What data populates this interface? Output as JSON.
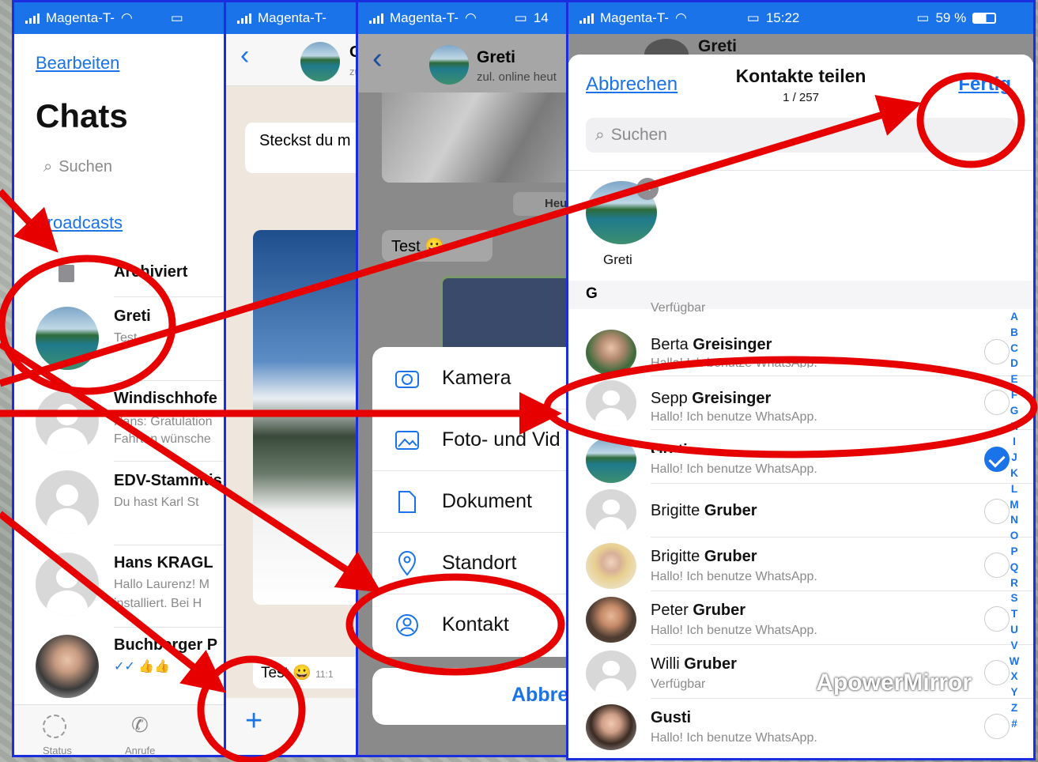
{
  "status": {
    "carrier": "Magenta-T-",
    "time": "15:22",
    "battery": "59 %",
    "time_short": "1",
    "time_p2": "14"
  },
  "p1": {
    "edit": "Bearbeiten",
    "title": "Chats",
    "search": "Suchen",
    "broadcasts": "Broadcasts",
    "archived": "Archiviert",
    "chats": [
      {
        "name": "Greti",
        "msg": "Test"
      },
      {
        "name": "Windischhofe",
        "msg": "Hans: Gratulation",
        "msg2": "Fahrten wünsche"
      },
      {
        "name": "EDV-Stammtis",
        "msg": "Du hast Karl St"
      },
      {
        "name": "Hans KRAGL",
        "msg": "Hallo Laurenz! M",
        "msg2": "installiert.  Bei H"
      },
      {
        "name": "Buchberger P",
        "msg": "✓✓ 👍👍"
      }
    ],
    "tabs": [
      "Status",
      "Anrufe"
    ]
  },
  "p2": {
    "contact": "G",
    "sub": "zu",
    "bubble1": "Steckst du m",
    "bubble2": "Test",
    "time": "11:1"
  },
  "p3": {
    "contact": "Greti",
    "sub": "zul. online heut",
    "date": "Heu",
    "bubble": "Test",
    "menu": [
      "Kamera",
      "Foto- und Vid",
      "Dokument",
      "Standort",
      "Kontakt"
    ],
    "cancel": "Abbre"
  },
  "p4": {
    "header_name": "Greti",
    "cancel": "Abbrechen",
    "title": "Kontakte teilen",
    "count": "1 / 257",
    "done": "Fertig",
    "search": "Suchen",
    "selected": "Greti",
    "section": "G",
    "partial": "Verfügbar",
    "contacts": [
      {
        "first": "Berta ",
        "last": "Greisinger",
        "status": "Hallo! Ich benutze WhatsApp.",
        "checked": false
      },
      {
        "first": "Sepp ",
        "last": "Greisinger",
        "status": "Hallo! Ich benutze WhatsApp.",
        "checked": false
      },
      {
        "first": "",
        "last": "Greti",
        "status": "Hallo! Ich benutze WhatsApp.",
        "checked": true
      },
      {
        "first": "Brigitte ",
        "last": "Gruber",
        "status": "",
        "checked": false
      },
      {
        "first": "Brigitte ",
        "last": "Gruber",
        "status": "Hallo! Ich benutze WhatsApp.",
        "checked": false
      },
      {
        "first": "Peter ",
        "last": "Gruber",
        "status": "Hallo! Ich benutze WhatsApp.",
        "checked": false
      },
      {
        "first": "Willi ",
        "last": "Gruber",
        "status": "Verfügbar",
        "checked": false
      },
      {
        "first": "",
        "last": "Gusti",
        "status": "Hallo! Ich benutze WhatsApp.",
        "checked": false
      }
    ],
    "alphabet": [
      "A",
      "B",
      "C",
      "D",
      "E",
      "F",
      "G",
      "H",
      "I",
      "J",
      "K",
      "L",
      "M",
      "N",
      "O",
      "P",
      "Q",
      "R",
      "S",
      "T",
      "U",
      "V",
      "W",
      "X",
      "Y",
      "Z",
      "#"
    ],
    "watermark": "ApowerMirror"
  }
}
